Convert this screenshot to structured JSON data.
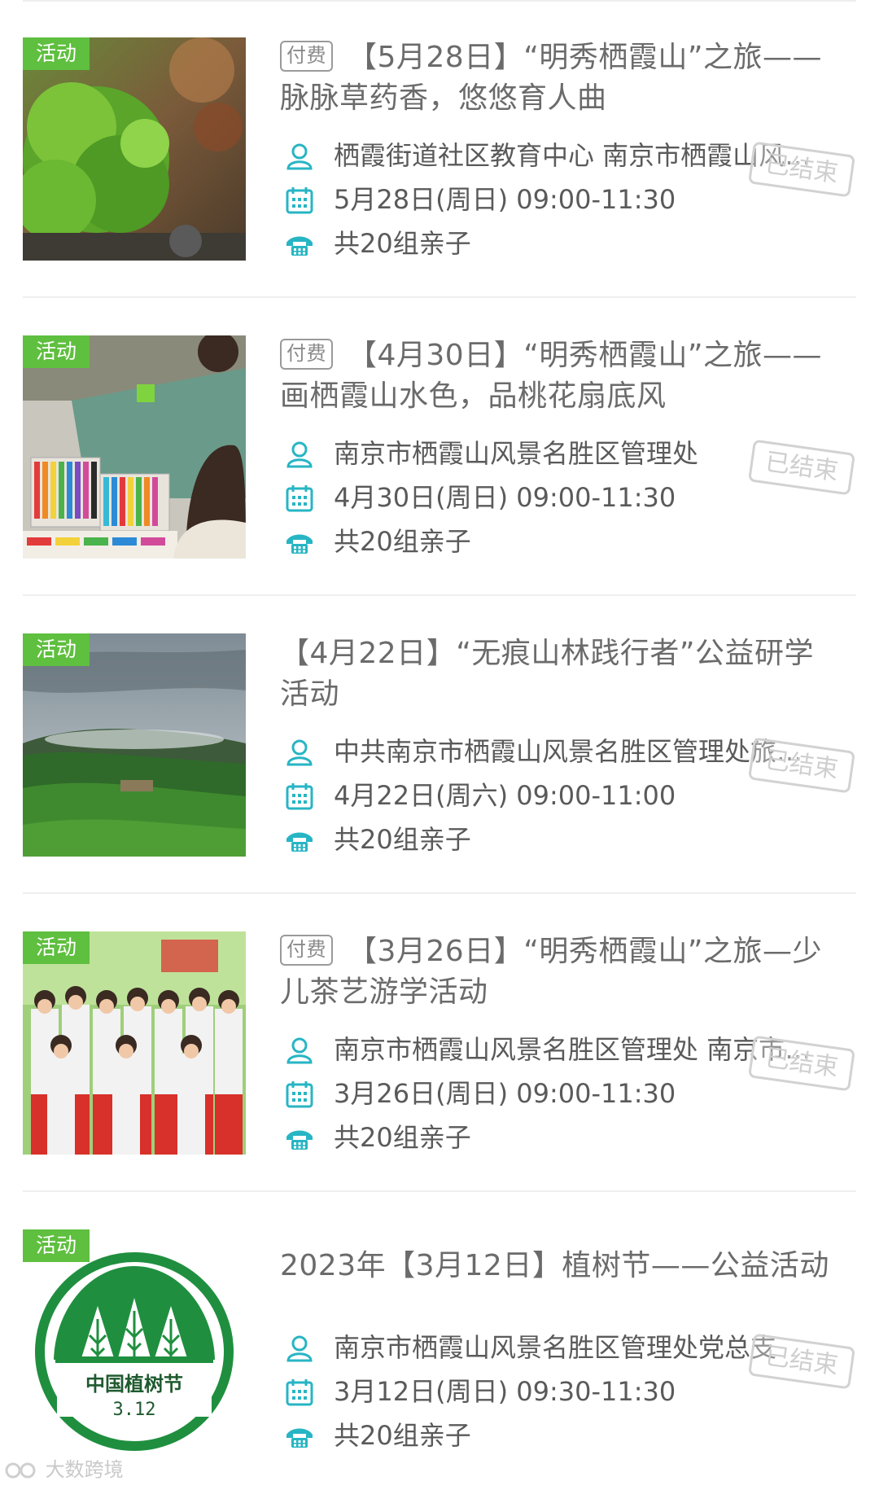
{
  "items": [
    {
      "tag": "活动",
      "pay_badge": "付费",
      "title": "【5月28日】“明秀栖霞山”之旅——脉脉草药香，悠悠育人曲",
      "organizer": "栖霞街道社区教育中心 南京市栖霞山风景名胜区管理处",
      "datetime": "5月28日(周日) 09:00-11:30",
      "quota": "共20组亲子",
      "status": "已结束",
      "image": "green-plants-photo"
    },
    {
      "tag": "活动",
      "pay_badge": "付费",
      "title": "【4月30日】“明秀栖霞山”之旅——画栖霞山水色，品桃花扇底风",
      "organizer": "南京市栖霞山风景名胜区管理处",
      "datetime": "4月30日(周日) 09:00-11:30",
      "quota": "共20组亲子",
      "status": "已结束",
      "image": "children-drawing-markers-photo"
    },
    {
      "tag": "活动",
      "pay_badge": "",
      "title": "【4月22日】“无痕山林践行者”公益研学活动",
      "organizer": "中共南京市栖霞山风景名胜区管理处旅游服务中心",
      "datetime": "4月22日(周六) 09:00-11:00",
      "quota": "共20组亲子",
      "status": "已结束",
      "image": "misty-mountain-photo"
    },
    {
      "tag": "活动",
      "pay_badge": "付费",
      "title": "【3月26日】“明秀栖霞山”之旅—少儿茶艺游学活动",
      "organizer": "南京市栖霞山风景名胜区管理处 南京市栖霞区",
      "datetime": "3月26日(周日) 09:00-11:30",
      "quota": "共20组亲子",
      "status": "已结束",
      "image": "children-hanfu-group-photo"
    },
    {
      "tag": "活动",
      "pay_badge": "",
      "title": "2023年【3月12日】植树节——公益活动",
      "organizer": "南京市栖霞山风景名胜区管理处党总支",
      "datetime": "3月12日(周日) 09:30-11:30",
      "quota": "共20组亲子",
      "status": "已结束",
      "image": "arbor-day-logo",
      "logo_text": "中国植树节",
      "logo_date": "3.12"
    }
  ],
  "icons": {
    "organizer": "person-icon",
    "datetime": "calendar-icon",
    "quota": "phone-icon"
  },
  "colors": {
    "tag_bg": "#5fbf3f",
    "icon": "#27b5c4",
    "logo_green": "#1f8f3f"
  },
  "watermark": "大数跨境"
}
